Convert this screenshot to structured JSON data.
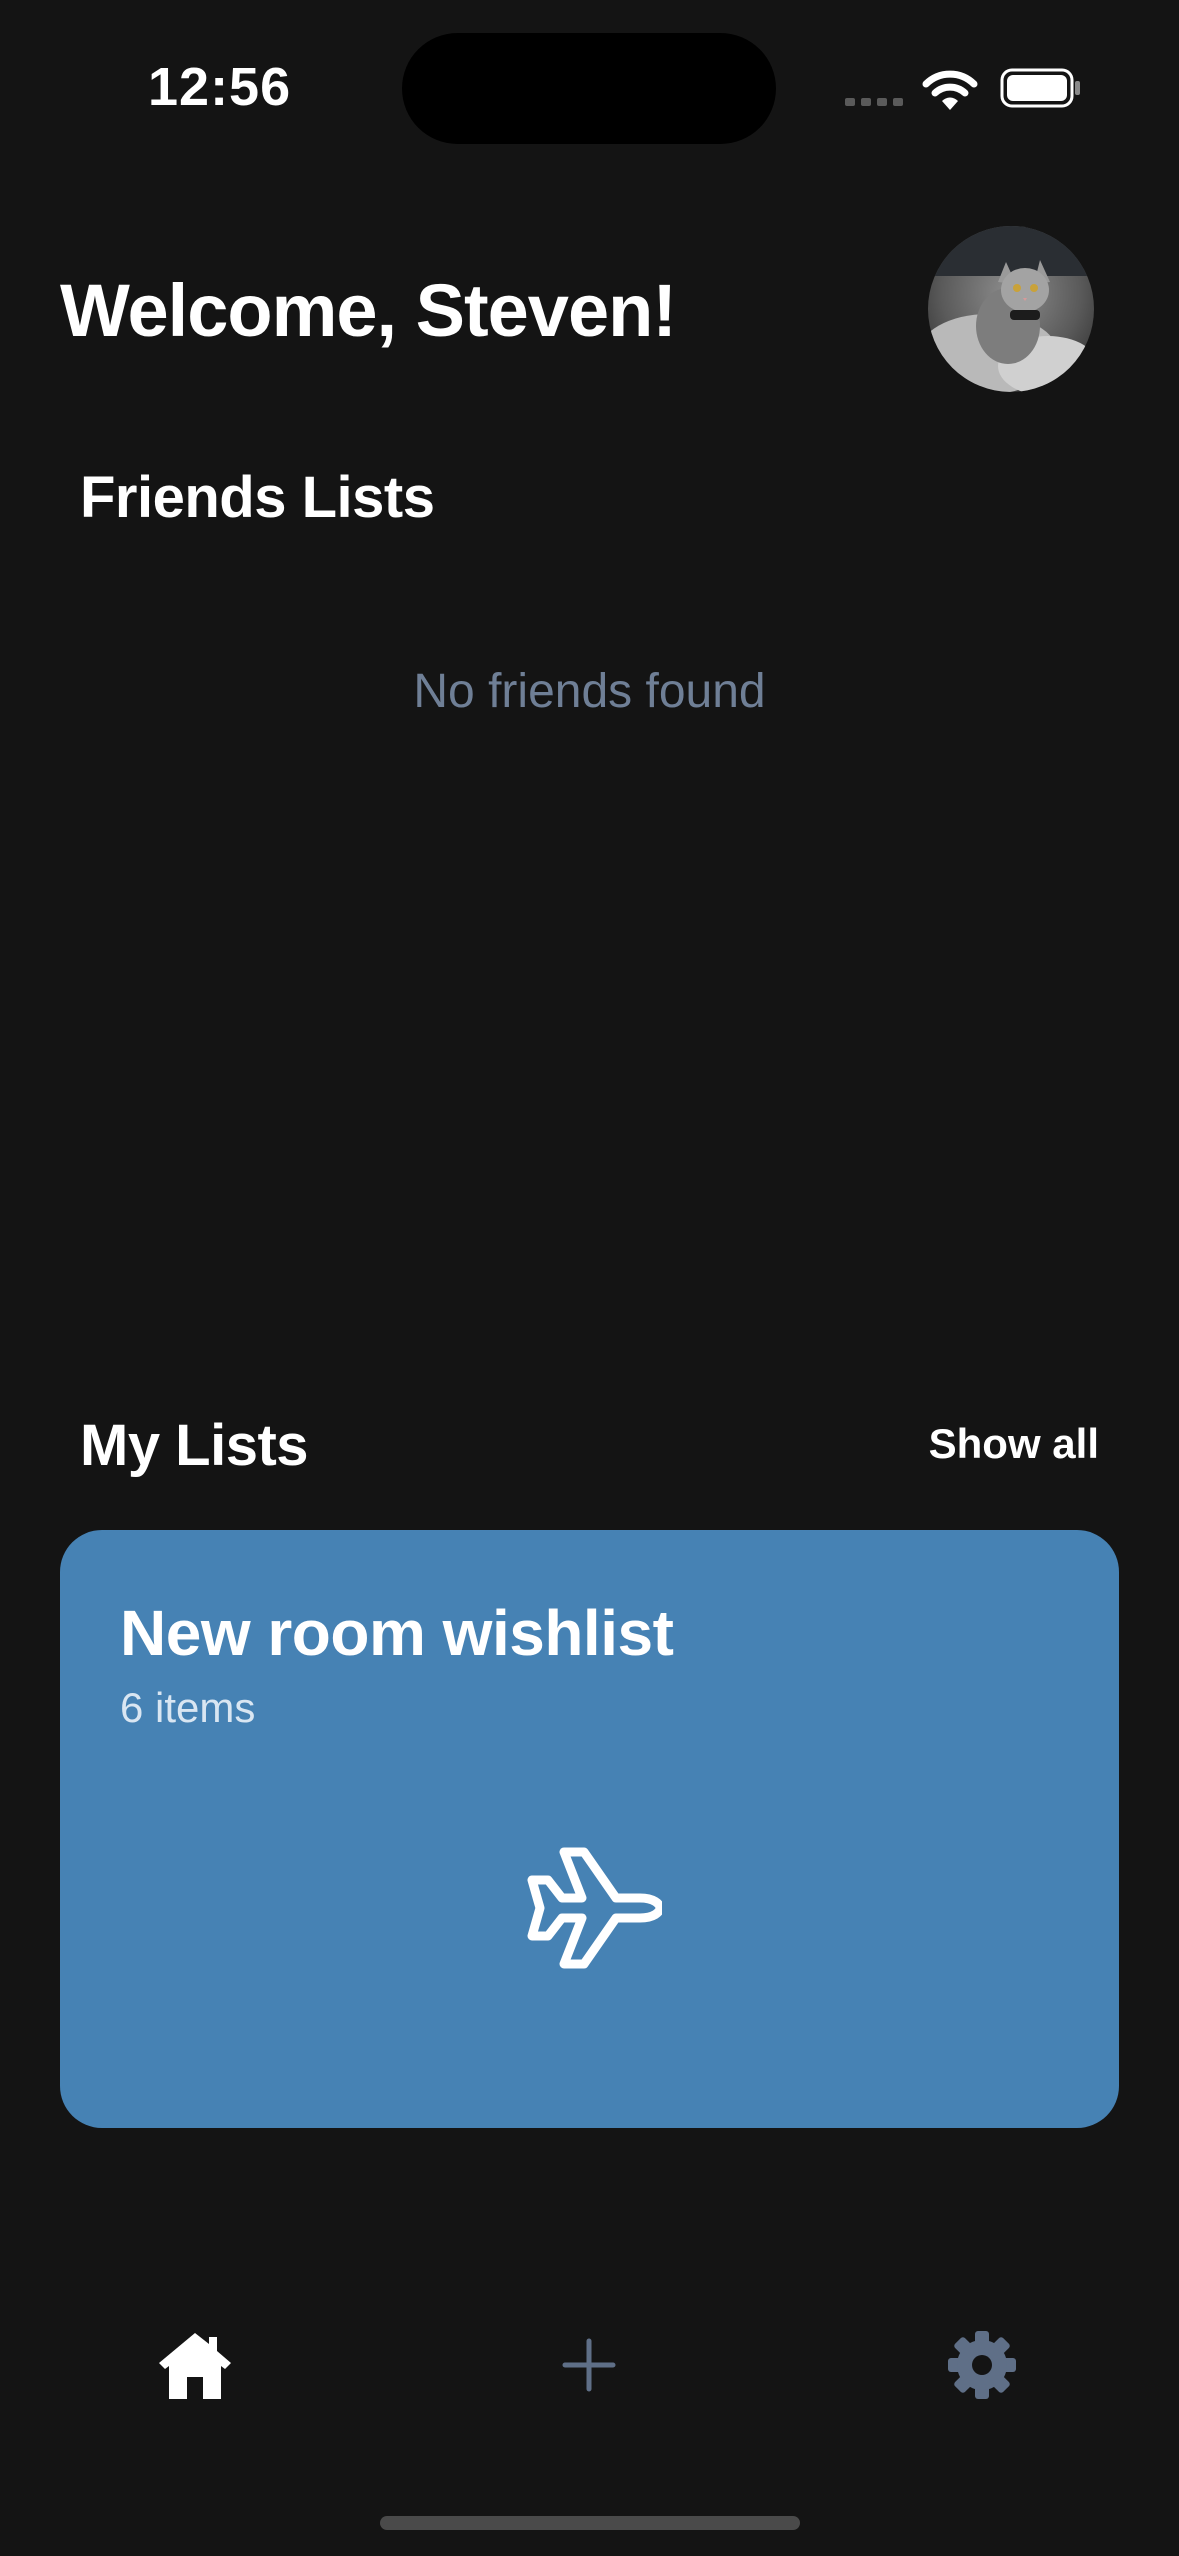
{
  "status_bar": {
    "time": "12:56"
  },
  "header": {
    "welcome": "Welcome, Steven!",
    "avatar_icon": "user-avatar-cat"
  },
  "friends": {
    "title": "Friends Lists",
    "empty_text": "No friends found"
  },
  "my_lists": {
    "title": "My Lists",
    "show_all_label": "Show all",
    "cards": [
      {
        "title": "New room wishlist",
        "count_text": "6 items",
        "icon": "airplane-icon",
        "color": "#4682b4"
      }
    ]
  },
  "tab_bar": {
    "items": [
      {
        "name": "home",
        "icon": "home-icon",
        "active": true
      },
      {
        "name": "add",
        "icon": "plus-icon",
        "active": false
      },
      {
        "name": "settings",
        "icon": "gear-icon",
        "active": false
      }
    ],
    "active_color": "#ffffff",
    "inactive_color": "#5f6f87"
  }
}
